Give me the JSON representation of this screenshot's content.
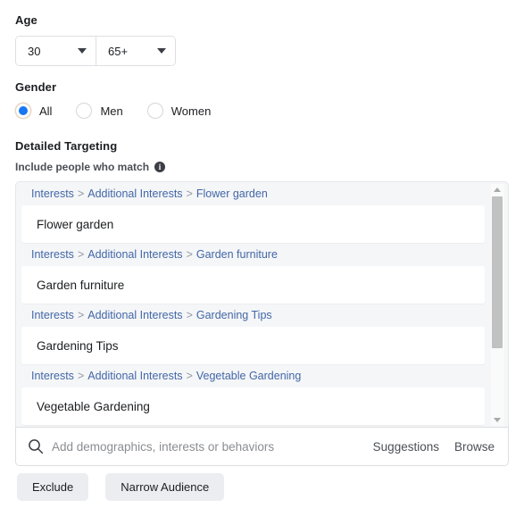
{
  "age": {
    "label": "Age",
    "min": {
      "value": "30",
      "icon": "chevron-down-icon"
    },
    "max": {
      "value": "65+",
      "icon": "chevron-down-icon"
    }
  },
  "gender": {
    "label": "Gender",
    "selected": "All",
    "options": [
      {
        "label": "All",
        "checked": true
      },
      {
        "label": "Men",
        "checked": false
      },
      {
        "label": "Women",
        "checked": false
      }
    ]
  },
  "detailed_targeting": {
    "title": "Detailed Targeting",
    "subtitle": "Include people who match",
    "info_icon": "i",
    "selections": [
      {
        "breadcrumb": [
          "Interests",
          "Additional Interests",
          "Flower garden"
        ],
        "name": "Flower garden"
      },
      {
        "breadcrumb": [
          "Interests",
          "Additional Interests",
          "Garden furniture"
        ],
        "name": "Garden furniture"
      },
      {
        "breadcrumb": [
          "Interests",
          "Additional Interests",
          "Gardening Tips"
        ],
        "name": "Gardening Tips"
      },
      {
        "breadcrumb": [
          "Interests",
          "Additional Interests",
          "Vegetable Gardening"
        ],
        "name": "Vegetable Gardening"
      }
    ],
    "separator": ">"
  },
  "search": {
    "icon": "search-icon",
    "value": "",
    "placeholder": "Add demographics, interests or behaviors",
    "suggestions_label": "Suggestions",
    "browse_label": "Browse"
  },
  "footer": {
    "exclude_label": "Exclude",
    "narrow_label": "Narrow Audience"
  },
  "colors": {
    "link": "#4267a8",
    "radio_selected": "#1877f2",
    "panel_bg": "#f5f6f7",
    "button_bg": "#ebedf0"
  }
}
